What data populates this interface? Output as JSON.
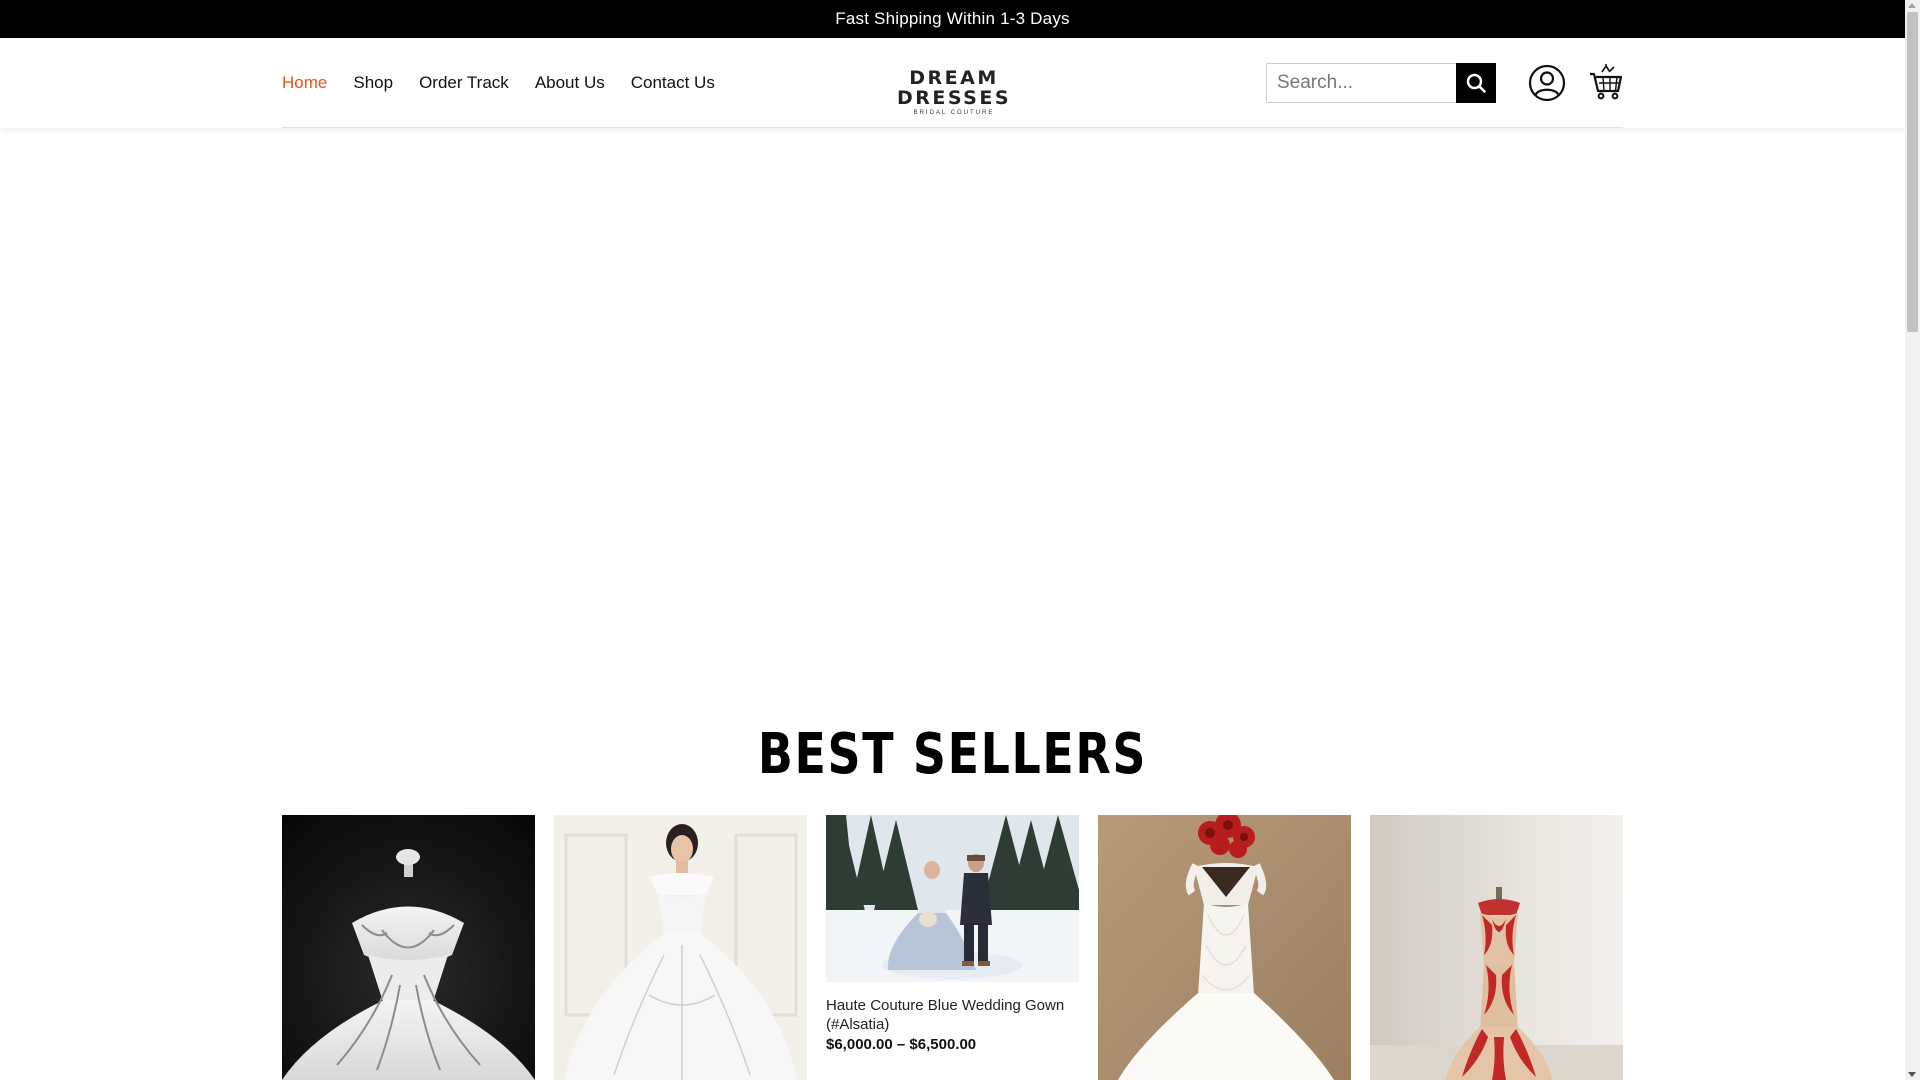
{
  "announcement": {
    "text": "Fast Shipping Within 1-3 Days"
  },
  "nav": {
    "items": [
      {
        "label": "Home",
        "active": true
      },
      {
        "label": "Shop",
        "active": false
      },
      {
        "label": "Order Track",
        "active": false
      },
      {
        "label": "About Us",
        "active": false
      },
      {
        "label": "Contact Us",
        "active": false
      }
    ]
  },
  "logo": {
    "main": "DREAM DRESSES",
    "sub": "BRIDAL COUTURE"
  },
  "search": {
    "placeholder": "Search...",
    "value": ""
  },
  "icons": {
    "search": "search-icon",
    "account": "user-icon",
    "cart": "cart-icon"
  },
  "colors": {
    "accent": "#e3561f",
    "announcement_bg": "#000000"
  },
  "best_sellers": {
    "title": "BEST SELLERS",
    "products": [
      {
        "image": "white-gown-silver-embellished-on-mannequin",
        "name": "",
        "price": ""
      },
      {
        "image": "model-in-white-off-shoulder-ball-gown",
        "name": "",
        "price": ""
      },
      {
        "image": "couple-in-snow-blue-wedding-gown",
        "name": "Haute Couture Blue Wedding Gown (#Alsatia)",
        "price": "$6,000.00 – $6,500.00"
      },
      {
        "image": "white-lace-mermaid-gown-with-red-roses",
        "name": "",
        "price": ""
      },
      {
        "image": "red-lace-mermaid-gown-on-mannequin",
        "name": "",
        "price": ""
      }
    ]
  }
}
